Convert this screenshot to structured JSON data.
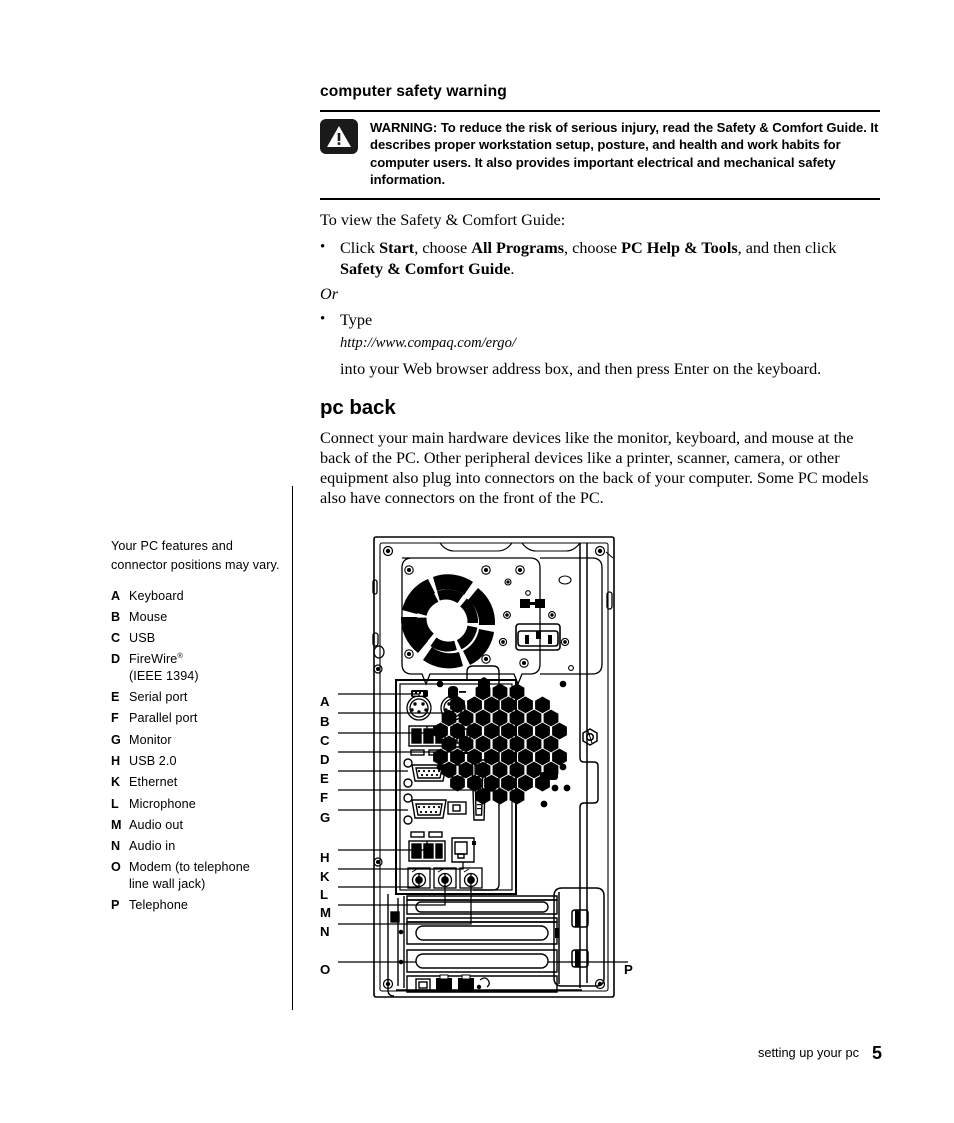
{
  "document": {
    "footer_text": "setting up your pc",
    "page_number": "5"
  },
  "safety_section": {
    "heading": "computer safety warning",
    "warning_icon": "warning-triangle-icon",
    "warning_text": "WARNING: To reduce the risk of serious injury, read the Safety & Comfort Guide. It describes proper workstation setup, posture, and health and work habits for computer users. It also provides important electrical and mechanical safety information.",
    "intro": "To view the Safety & Comfort Guide:",
    "bullet1": {
      "marker": "•",
      "part1": "Click ",
      "bold1": "Start",
      "part2": ", choose ",
      "bold2": "All Programs",
      "part3": ", choose ",
      "bold3": "PC Help & Tools",
      "part4": ", and then click ",
      "bold4": "Safety & Comfort Guide",
      "part5": "."
    },
    "or_label": "Or",
    "bullet2": {
      "marker": "•",
      "text": "Type",
      "url": "http://www.compaq.com/ergo/",
      "after": "into your Web browser address box, and then press Enter on the keyboard."
    }
  },
  "pc_back_section": {
    "heading": "pc back",
    "paragraph": "Connect your main hardware devices like the monitor, keyboard, and mouse at the back of the PC. Other peripheral devices like a printer, scanner, camera, or other equipment also plug into connectors on the back of your computer. Some PC models also have connectors on the front of the PC."
  },
  "sidebar": {
    "note": "Your PC features and connector positions may vary.",
    "legend": [
      {
        "letter": "A",
        "label": "Keyboard",
        "sup": ""
      },
      {
        "letter": "B",
        "label": "Mouse",
        "sup": ""
      },
      {
        "letter": "C",
        "label": "USB",
        "sup": ""
      },
      {
        "letter": "D",
        "label": "FireWire",
        "sup": "®",
        "label2": "(IEEE 1394)"
      },
      {
        "letter": "E",
        "label": "Serial port",
        "sup": ""
      },
      {
        "letter": "F",
        "label": "Parallel port",
        "sup": ""
      },
      {
        "letter": "G",
        "label": "Monitor",
        "sup": ""
      },
      {
        "letter": "H",
        "label": "USB 2.0",
        "sup": ""
      },
      {
        "letter": "K",
        "label": "Ethernet",
        "sup": ""
      },
      {
        "letter": "L",
        "label": "Microphone",
        "sup": ""
      },
      {
        "letter": "M",
        "label": "Audio out",
        "sup": ""
      },
      {
        "letter": "N",
        "label": "Audio in",
        "sup": ""
      },
      {
        "letter": "O",
        "label": "Modem (to telephone",
        "sup": "",
        "label2": "line wall jack)"
      },
      {
        "letter": "P",
        "label": "Telephone",
        "sup": ""
      }
    ]
  },
  "diagram": {
    "name": "pc-back-panel-illustration",
    "callouts": [
      {
        "letter": "A",
        "target": "ps2-keyboard-port"
      },
      {
        "letter": "B",
        "target": "ps2-mouse-port"
      },
      {
        "letter": "C",
        "target": "usb-ports"
      },
      {
        "letter": "D",
        "target": "firewire-port"
      },
      {
        "letter": "E",
        "target": "serial-port"
      },
      {
        "letter": "F",
        "target": "parallel-port"
      },
      {
        "letter": "G",
        "target": "monitor-vga-port"
      },
      {
        "letter": "H",
        "target": "usb2-ports"
      },
      {
        "letter": "K",
        "target": "ethernet-port"
      },
      {
        "letter": "L",
        "target": "microphone-jack"
      },
      {
        "letter": "M",
        "target": "audio-out-jack"
      },
      {
        "letter": "N",
        "target": "audio-in-jack"
      },
      {
        "letter": "O",
        "target": "modem-jack"
      },
      {
        "letter": "P",
        "target": "telephone-jack"
      }
    ]
  },
  "colors": {
    "ink": "#000000",
    "paper": "#ffffff",
    "icon_fill": "#1a1a1a"
  }
}
